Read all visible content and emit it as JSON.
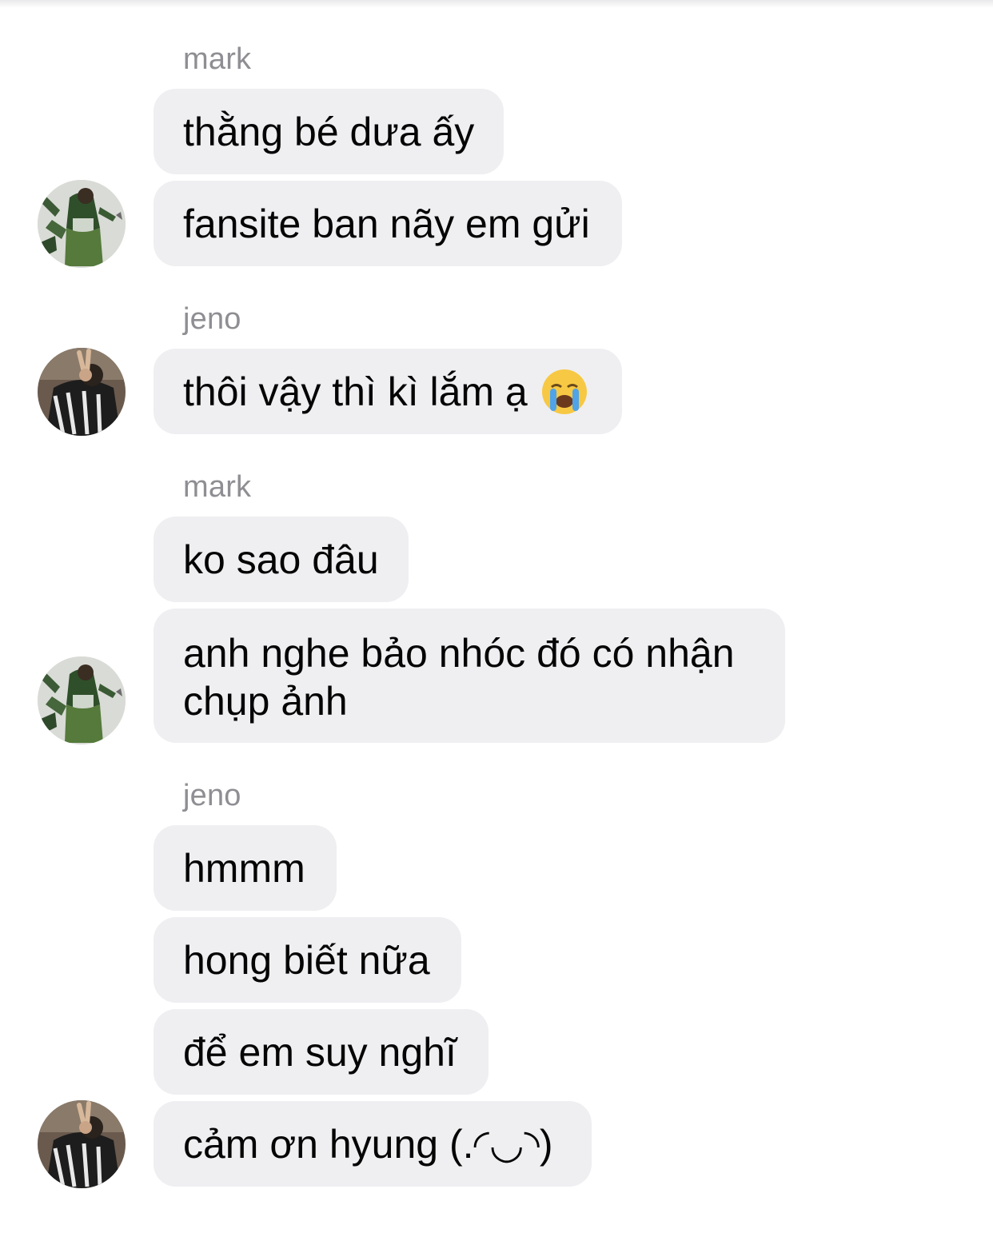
{
  "conversation": {
    "groups": [
      {
        "sender": "mark",
        "avatar": "mark-avatar",
        "messages": [
          "thằng bé dưa ấy",
          "fansite ban nãy em gửi"
        ]
      },
      {
        "sender": "jeno",
        "avatar": "jeno-avatar",
        "messages": [
          "thôi vậy thì kì lắm ạ"
        ],
        "emoji": "loudly-crying-face-icon"
      },
      {
        "sender": "mark",
        "avatar": "mark-avatar",
        "messages": [
          "ko sao đâu",
          "anh nghe bảo nhóc đó có nhận chụp ảnh"
        ]
      },
      {
        "sender": "jeno",
        "avatar": "jeno-avatar",
        "messages": [
          "hmmm",
          "hong biết nữa",
          "để em suy nghĩ",
          "cảm ơn hyung (.◜◡◝)"
        ]
      }
    ]
  },
  "colors": {
    "bubble_bg": "#efeff2",
    "sender_name": "#8e8e93",
    "message_text": "#050505",
    "background": "#ffffff"
  }
}
